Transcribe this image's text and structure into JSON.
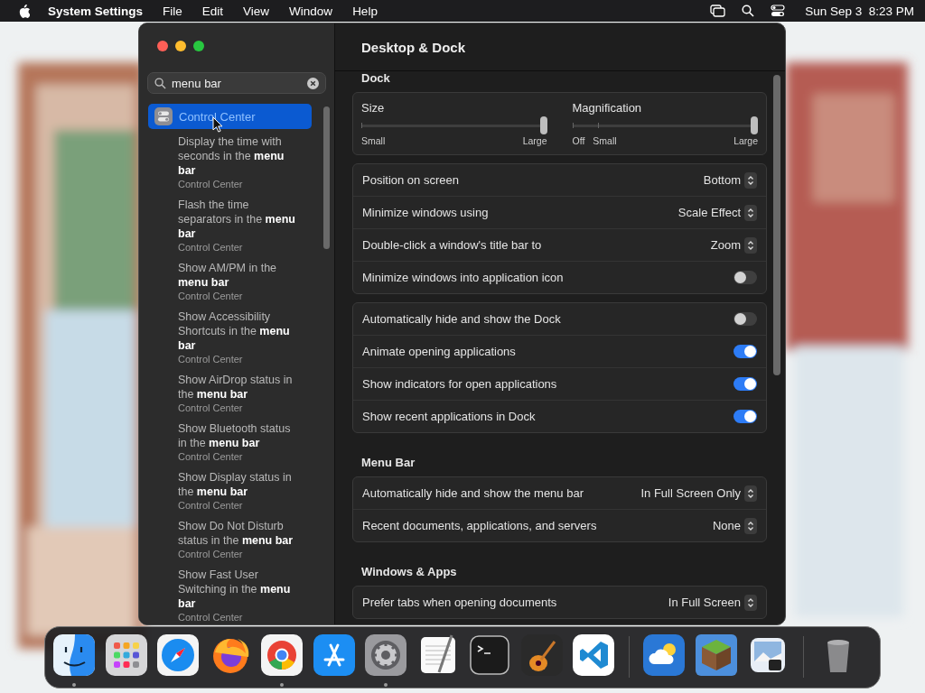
{
  "menu_bar": {
    "app_name": "System Settings",
    "menus": [
      "File",
      "Edit",
      "View",
      "Window",
      "Help"
    ],
    "clock": "Sun Sep 3  8:23 PM"
  },
  "window": {
    "title": "Desktop & Dock",
    "search": {
      "value": "menu bar"
    },
    "sidebar": {
      "items": [
        {
          "kind": "pane",
          "label": "Control Center",
          "selected": true
        },
        {
          "kind": "result",
          "label": "Display the time with seconds in the **menu bar**",
          "source": "Control Center",
          "selected": false
        },
        {
          "kind": "result",
          "label": "Flash the time separators in the **menu bar**",
          "source": "Control Center",
          "selected": false
        },
        {
          "kind": "result",
          "label": "Show AM/PM in the **menu bar**",
          "source": "Control Center",
          "selected": false
        },
        {
          "kind": "result",
          "label": "Show Accessibility Shortcuts in the **menu bar**",
          "source": "Control Center",
          "selected": false
        },
        {
          "kind": "result",
          "label": "Show AirDrop status in the **menu bar**",
          "source": "Control Center",
          "selected": false
        },
        {
          "kind": "result",
          "label": "Show Bluetooth status in the **menu bar**",
          "source": "Control Center",
          "selected": false
        },
        {
          "kind": "result",
          "label": "Show Display status in the **menu bar**",
          "source": "Control Center",
          "selected": false
        },
        {
          "kind": "result",
          "label": "Show Do Not Disturb status in the **menu bar**",
          "source": "Control Center",
          "selected": false
        },
        {
          "kind": "result",
          "label": "Show Fast User Switching in the **menu bar**",
          "source": "Control Center",
          "selected": false
        }
      ]
    },
    "sections": [
      {
        "title": "Dock",
        "groups": [
          {
            "kind": "sliders",
            "sliders": [
              {
                "label": "Size",
                "level": 1,
                "scale": [
                  "Small",
                  "Large"
                ]
              },
              {
                "label": "Magnification",
                "level": 1,
                "scale": [
                  "Off",
                  "Small",
                  "Large"
                ]
              }
            ]
          },
          {
            "kind": "rows",
            "rows": [
              {
                "kind": "popup",
                "label": "Position on screen",
                "value": "Bottom"
              },
              {
                "kind": "popup",
                "label": "Minimize windows using",
                "value": "Scale Effect"
              },
              {
                "kind": "popup",
                "label": "Double-click a window's title bar to",
                "value": "Zoom"
              },
              {
                "kind": "toggle",
                "label": "Minimize windows into application icon",
                "on": false
              }
            ]
          },
          {
            "kind": "rows",
            "rows": [
              {
                "kind": "toggle",
                "label": "Automatically hide and show the Dock",
                "on": false
              },
              {
                "kind": "toggle",
                "label": "Animate opening applications",
                "on": true
              },
              {
                "kind": "toggle",
                "label": "Show indicators for open applications",
                "on": true
              },
              {
                "kind": "toggle",
                "label": "Show recent applications in Dock",
                "on": true
              }
            ]
          }
        ]
      },
      {
        "title": "Menu Bar",
        "groups": [
          {
            "kind": "rows",
            "rows": [
              {
                "kind": "popup",
                "label": "Automatically hide and show the menu bar",
                "value": "In Full Screen Only"
              },
              {
                "kind": "popup",
                "label": "Recent documents, applications, and servers",
                "value": "None"
              }
            ]
          }
        ]
      },
      {
        "title": "Windows & Apps",
        "groups": [
          {
            "kind": "rows",
            "rows": [
              {
                "kind": "popup",
                "label": "Prefer tabs when opening documents",
                "value": "In Full Screen"
              }
            ]
          }
        ]
      }
    ]
  },
  "dock": {
    "groups": [
      {
        "apps": [
          {
            "kind": "finder",
            "running": true
          },
          {
            "kind": "launchpad",
            "running": false
          },
          {
            "kind": "safari",
            "running": false
          },
          {
            "kind": "firefox",
            "running": false
          },
          {
            "kind": "chrome",
            "running": true
          },
          {
            "kind": "appstore",
            "running": false
          },
          {
            "kind": "settings",
            "running": true
          },
          {
            "kind": "textedit",
            "running": false
          },
          {
            "kind": "terminal",
            "running": false
          },
          {
            "kind": "garageband",
            "running": false
          },
          {
            "kind": "vscode",
            "running": false
          }
        ]
      },
      {
        "apps": [
          {
            "kind": "weather",
            "running": false
          },
          {
            "kind": "minecraft",
            "running": false
          },
          {
            "kind": "preview",
            "running": false
          }
        ]
      },
      {
        "apps": [
          {
            "kind": "trash",
            "running": false
          }
        ]
      }
    ]
  }
}
